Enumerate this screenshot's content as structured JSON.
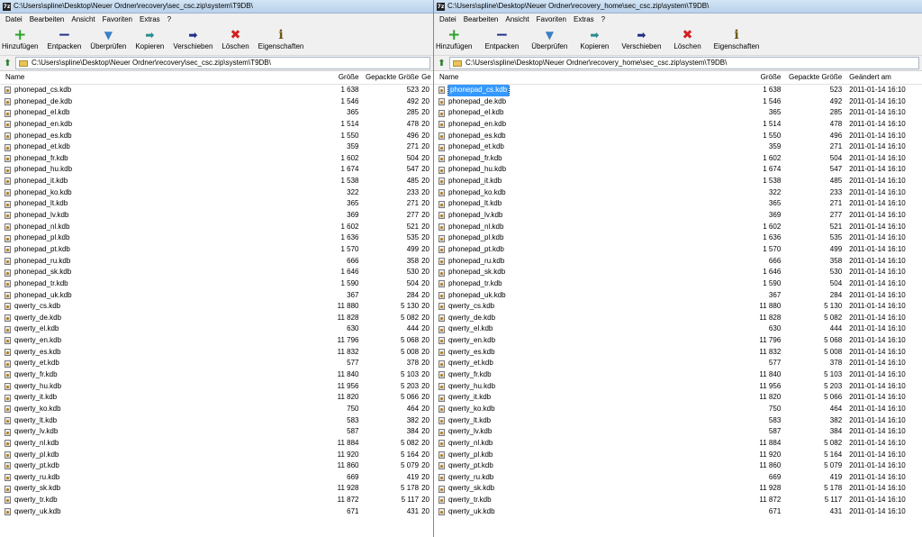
{
  "left": {
    "title": "C:\\Users\\spline\\Desktop\\Neuer Ordner\\recovery\\sec_csc.zip\\system\\T9DB\\",
    "menu": [
      "Datei",
      "Bearbeiten",
      "Ansicht",
      "Favoriten",
      "Extras",
      "?"
    ],
    "toolbar": [
      "Hinzufügen",
      "Entpacken",
      "Überprüfen",
      "Kopieren",
      "Verschieben",
      "Löschen",
      "Eigenschaften"
    ],
    "address": "C:\\Users\\spline\\Desktop\\Neuer Ordner\\recovery\\sec_csc.zip\\system\\T9DB\\",
    "columns": [
      "Name",
      "Größe",
      "Gepackte Größe",
      "Ge"
    ],
    "rows": [
      [
        "phonepad_cs.kdb",
        "1 638",
        "523",
        "20"
      ],
      [
        "phonepad_de.kdb",
        "1 546",
        "492",
        "20"
      ],
      [
        "phonepad_el.kdb",
        "365",
        "285",
        "20"
      ],
      [
        "phonepad_en.kdb",
        "1 514",
        "478",
        "20"
      ],
      [
        "phonepad_es.kdb",
        "1 550",
        "496",
        "20"
      ],
      [
        "phonepad_et.kdb",
        "359",
        "271",
        "20"
      ],
      [
        "phonepad_fr.kdb",
        "1 602",
        "504",
        "20"
      ],
      [
        "phonepad_hu.kdb",
        "1 674",
        "547",
        "20"
      ],
      [
        "phonepad_it.kdb",
        "1 538",
        "485",
        "20"
      ],
      [
        "phonepad_ko.kdb",
        "322",
        "233",
        "20"
      ],
      [
        "phonepad_lt.kdb",
        "365",
        "271",
        "20"
      ],
      [
        "phonepad_lv.kdb",
        "369",
        "277",
        "20"
      ],
      [
        "phonepad_nl.kdb",
        "1 602",
        "521",
        "20"
      ],
      [
        "phonepad_pl.kdb",
        "1 636",
        "535",
        "20"
      ],
      [
        "phonepad_pt.kdb",
        "1 570",
        "499",
        "20"
      ],
      [
        "phonepad_ru.kdb",
        "666",
        "358",
        "20"
      ],
      [
        "phonepad_sk.kdb",
        "1 646",
        "530",
        "20"
      ],
      [
        "phonepad_tr.kdb",
        "1 590",
        "504",
        "20"
      ],
      [
        "phonepad_uk.kdb",
        "367",
        "284",
        "20"
      ],
      [
        "qwerty_cs.kdb",
        "11 880",
        "5 130",
        "20"
      ],
      [
        "qwerty_de.kdb",
        "11 828",
        "5 082",
        "20"
      ],
      [
        "qwerty_el.kdb",
        "630",
        "444",
        "20"
      ],
      [
        "qwerty_en.kdb",
        "11 796",
        "5 068",
        "20"
      ],
      [
        "qwerty_es.kdb",
        "11 832",
        "5 008",
        "20"
      ],
      [
        "qwerty_et.kdb",
        "577",
        "378",
        "20"
      ],
      [
        "qwerty_fr.kdb",
        "11 840",
        "5 103",
        "20"
      ],
      [
        "qwerty_hu.kdb",
        "11 956",
        "5 203",
        "20"
      ],
      [
        "qwerty_it.kdb",
        "11 820",
        "5 066",
        "20"
      ],
      [
        "qwerty_ko.kdb",
        "750",
        "464",
        "20"
      ],
      [
        "qwerty_lt.kdb",
        "583",
        "382",
        "20"
      ],
      [
        "qwerty_lv.kdb",
        "587",
        "384",
        "20"
      ],
      [
        "qwerty_nl.kdb",
        "11 884",
        "5 082",
        "20"
      ],
      [
        "qwerty_pl.kdb",
        "11 920",
        "5 164",
        "20"
      ],
      [
        "qwerty_pt.kdb",
        "11 860",
        "5 079",
        "20"
      ],
      [
        "qwerty_ru.kdb",
        "669",
        "419",
        "20"
      ],
      [
        "qwerty_sk.kdb",
        "11 928",
        "5 178",
        "20"
      ],
      [
        "qwerty_tr.kdb",
        "11 872",
        "5 117",
        "20"
      ],
      [
        "qwerty_uk.kdb",
        "671",
        "431",
        "20"
      ]
    ]
  },
  "right": {
    "title": "C:\\Users\\spline\\Desktop\\Neuer Ordner\\recovery_home\\sec_csc.zip\\system\\T9DB\\",
    "menu": [
      "Datei",
      "Bearbeiten",
      "Ansicht",
      "Favoriten",
      "Extras",
      "?"
    ],
    "toolbar": [
      "Hinzufügen",
      "Entpacken",
      "Überprüfen",
      "Kopieren",
      "Verschieben",
      "Löschen",
      "Eigenschaften"
    ],
    "address": "C:\\Users\\spline\\Desktop\\Neuer Ordner\\recovery_home\\sec_csc.zip\\system\\T9DB\\",
    "columns": [
      "Name",
      "Größe",
      "Gepackte Größe",
      "Geändert am"
    ],
    "rows": [
      [
        "phonepad_cs.kdb",
        "1 638",
        "523",
        "2011-01-14 16:10"
      ],
      [
        "phonepad_de.kdb",
        "1 546",
        "492",
        "2011-01-14 16:10"
      ],
      [
        "phonepad_el.kdb",
        "365",
        "285",
        "2011-01-14 16:10"
      ],
      [
        "phonepad_en.kdb",
        "1 514",
        "478",
        "2011-01-14 16:10"
      ],
      [
        "phonepad_es.kdb",
        "1 550",
        "496",
        "2011-01-14 16:10"
      ],
      [
        "phonepad_et.kdb",
        "359",
        "271",
        "2011-01-14 16:10"
      ],
      [
        "phonepad_fr.kdb",
        "1 602",
        "504",
        "2011-01-14 16:10"
      ],
      [
        "phonepad_hu.kdb",
        "1 674",
        "547",
        "2011-01-14 16:10"
      ],
      [
        "phonepad_it.kdb",
        "1 538",
        "485",
        "2011-01-14 16:10"
      ],
      [
        "phonepad_ko.kdb",
        "322",
        "233",
        "2011-01-14 16:10"
      ],
      [
        "phonepad_lt.kdb",
        "365",
        "271",
        "2011-01-14 16:10"
      ],
      [
        "phonepad_lv.kdb",
        "369",
        "277",
        "2011-01-14 16:10"
      ],
      [
        "phonepad_nl.kdb",
        "1 602",
        "521",
        "2011-01-14 16:10"
      ],
      [
        "phonepad_pl.kdb",
        "1 636",
        "535",
        "2011-01-14 16:10"
      ],
      [
        "phonepad_pt.kdb",
        "1 570",
        "499",
        "2011-01-14 16:10"
      ],
      [
        "phonepad_ru.kdb",
        "666",
        "358",
        "2011-01-14 16:10"
      ],
      [
        "phonepad_sk.kdb",
        "1 646",
        "530",
        "2011-01-14 16:10"
      ],
      [
        "phonepad_tr.kdb",
        "1 590",
        "504",
        "2011-01-14 16:10"
      ],
      [
        "phonepad_uk.kdb",
        "367",
        "284",
        "2011-01-14 16:10"
      ],
      [
        "qwerty_cs.kdb",
        "11 880",
        "5 130",
        "2011-01-14 16:10"
      ],
      [
        "qwerty_de.kdb",
        "11 828",
        "5 082",
        "2011-01-14 16:10"
      ],
      [
        "qwerty_el.kdb",
        "630",
        "444",
        "2011-01-14 16:10"
      ],
      [
        "qwerty_en.kdb",
        "11 796",
        "5 068",
        "2011-01-14 16:10"
      ],
      [
        "qwerty_es.kdb",
        "11 832",
        "5 008",
        "2011-01-14 16:10"
      ],
      [
        "qwerty_et.kdb",
        "577",
        "378",
        "2011-01-14 16:10"
      ],
      [
        "qwerty_fr.kdb",
        "11 840",
        "5 103",
        "2011-01-14 16:10"
      ],
      [
        "qwerty_hu.kdb",
        "11 956",
        "5 203",
        "2011-01-14 16:10"
      ],
      [
        "qwerty_it.kdb",
        "11 820",
        "5 066",
        "2011-01-14 16:10"
      ],
      [
        "qwerty_ko.kdb",
        "750",
        "464",
        "2011-01-14 16:10"
      ],
      [
        "qwerty_lt.kdb",
        "583",
        "382",
        "2011-01-14 16:10"
      ],
      [
        "qwerty_lv.kdb",
        "587",
        "384",
        "2011-01-14 16:10"
      ],
      [
        "qwerty_nl.kdb",
        "11 884",
        "5 082",
        "2011-01-14 16:10"
      ],
      [
        "qwerty_pl.kdb",
        "11 920",
        "5 164",
        "2011-01-14 16:10"
      ],
      [
        "qwerty_pt.kdb",
        "11 860",
        "5 079",
        "2011-01-14 16:10"
      ],
      [
        "qwerty_ru.kdb",
        "669",
        "419",
        "2011-01-14 16:10"
      ],
      [
        "qwerty_sk.kdb",
        "11 928",
        "5 178",
        "2011-01-14 16:10"
      ],
      [
        "qwerty_tr.kdb",
        "11 872",
        "5 117",
        "2011-01-14 16:10"
      ],
      [
        "qwerty_uk.kdb",
        "671",
        "431",
        "2011-01-14 16:10"
      ]
    ],
    "selected_row": 0
  },
  "toolbar_icons": [
    "plus-icon",
    "minus-icon",
    "check-icon",
    "copy-arrow-icon",
    "move-arrow-icon",
    "delete-x-icon",
    "info-icon"
  ],
  "colors": {
    "selection": "#3399ff",
    "add": "#2aa52a",
    "delete": "#d42020",
    "move": "#1f2d8a"
  }
}
